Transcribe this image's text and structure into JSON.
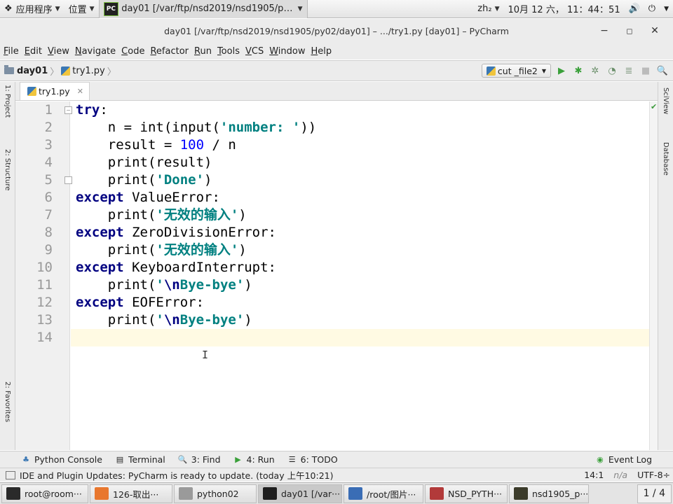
{
  "top_panel": {
    "applications_label": "应用程序",
    "places_label": "位置",
    "active_task_label": "day01 [/var/ftp/nsd2019/nsd1905/py···",
    "input_method": "zh₂",
    "datetime": "10月 12 六， 11：44：51"
  },
  "window": {
    "title": "day01 [/var/ftp/nsd2019/nsd1905/py02/day01] – .../try1.py [day01] – PyCharm"
  },
  "menu": {
    "items": [
      {
        "mnemonic": "F",
        "rest": "ile"
      },
      {
        "mnemonic": "E",
        "rest": "dit"
      },
      {
        "mnemonic": "V",
        "rest": "iew"
      },
      {
        "mnemonic": "N",
        "rest": "avigate"
      },
      {
        "mnemonic": "C",
        "rest": "ode"
      },
      {
        "mnemonic": "R",
        "rest": "efactor"
      },
      {
        "mnemonic": "R",
        "rest": "un"
      },
      {
        "mnemonic": "T",
        "rest": "ools"
      },
      {
        "mnemonic": "V",
        "rest": "CS"
      },
      {
        "mnemonic": "W",
        "rest": "indow"
      },
      {
        "mnemonic": "H",
        "rest": "elp"
      }
    ]
  },
  "nav": {
    "project": "day01",
    "file": "try1.py",
    "run_config": "cut _file2"
  },
  "side": {
    "left_top": "1: Project",
    "left_middle": "2: Structure",
    "left_bottom": "2: Favorites",
    "right_top": "SciView",
    "right_bottom": "Database"
  },
  "editor": {
    "tab": "try1.py",
    "current_line": 14,
    "lines": [
      {
        "no": "1",
        "indent": "",
        "tokens": [
          {
            "c": "kw",
            "t": "try"
          },
          {
            "c": "",
            "t": ":"
          }
        ]
      },
      {
        "no": "2",
        "indent": "    ",
        "tokens": [
          {
            "c": "",
            "t": "n = int(input("
          },
          {
            "c": "str",
            "t": "'number: '"
          },
          {
            "c": "",
            "t": "))"
          }
        ]
      },
      {
        "no": "3",
        "indent": "    ",
        "tokens": [
          {
            "c": "",
            "t": "result = "
          },
          {
            "c": "num",
            "t": "100"
          },
          {
            "c": "",
            "t": " / n"
          }
        ]
      },
      {
        "no": "4",
        "indent": "    ",
        "tokens": [
          {
            "c": "",
            "t": "print(result)"
          }
        ]
      },
      {
        "no": "5",
        "indent": "    ",
        "tokens": [
          {
            "c": "",
            "t": "print("
          },
          {
            "c": "str",
            "t": "'Done'"
          },
          {
            "c": "",
            "t": ")"
          }
        ]
      },
      {
        "no": "6",
        "indent": "",
        "tokens": [
          {
            "c": "kw",
            "t": "except"
          },
          {
            "c": "",
            "t": " ValueError:"
          }
        ]
      },
      {
        "no": "7",
        "indent": "    ",
        "tokens": [
          {
            "c": "",
            "t": "print("
          },
          {
            "c": "str",
            "t": "'无效的输入'"
          },
          {
            "c": "",
            "t": ")"
          }
        ]
      },
      {
        "no": "8",
        "indent": "",
        "tokens": [
          {
            "c": "kw",
            "t": "except"
          },
          {
            "c": "",
            "t": " ZeroDivisionError:"
          }
        ]
      },
      {
        "no": "9",
        "indent": "    ",
        "tokens": [
          {
            "c": "",
            "t": "print("
          },
          {
            "c": "str",
            "t": "'无效的输入'"
          },
          {
            "c": "",
            "t": ")"
          }
        ]
      },
      {
        "no": "10",
        "indent": "",
        "tokens": [
          {
            "c": "kw",
            "t": "except"
          },
          {
            "c": "",
            "t": " KeyboardInterrupt:"
          }
        ]
      },
      {
        "no": "11",
        "indent": "    ",
        "tokens": [
          {
            "c": "",
            "t": "print("
          },
          {
            "c": "str",
            "t": "'"
          },
          {
            "c": "esc",
            "t": "\\n"
          },
          {
            "c": "str",
            "t": "Bye-bye'"
          },
          {
            "c": "",
            "t": ")"
          }
        ]
      },
      {
        "no": "12",
        "indent": "",
        "tokens": [
          {
            "c": "kw",
            "t": "except"
          },
          {
            "c": "",
            "t": " EOFError:"
          }
        ]
      },
      {
        "no": "13",
        "indent": "    ",
        "tokens": [
          {
            "c": "",
            "t": "print("
          },
          {
            "c": "str",
            "t": "'"
          },
          {
            "c": "esc",
            "t": "\\n"
          },
          {
            "c": "str",
            "t": "Bye-bye'"
          },
          {
            "c": "",
            "t": ")"
          }
        ]
      },
      {
        "no": "14",
        "indent": "",
        "tokens": []
      }
    ]
  },
  "tools": {
    "python_console": "Python Console",
    "terminal": "Terminal",
    "find": "3: Find",
    "run": "4: Run",
    "todo": "6: TODO",
    "event_log": "Event Log"
  },
  "status": {
    "message": "IDE and Plugin Updates: PyCharm is ready to update. (today 上午10:21)",
    "position": "14:1",
    "na": "n/a",
    "encoding": "UTF-8÷"
  },
  "taskbar": {
    "items": [
      {
        "label": "root@room···",
        "color": "#2a2a2a"
      },
      {
        "label": "126-取出···",
        "color": "#e8772e"
      },
      {
        "label": "python02",
        "color": "#9a9a9a"
      },
      {
        "label": "day01 [/var···",
        "color": "#1e1e1e"
      },
      {
        "label": "/root/图片···",
        "color": "#3a6db5"
      },
      {
        "label": "NSD_PYTH···",
        "color": "#b23a3a"
      },
      {
        "label": "nsd1905_p···",
        "color": "#3b3b2a"
      }
    ],
    "pager": "1 / 4"
  }
}
